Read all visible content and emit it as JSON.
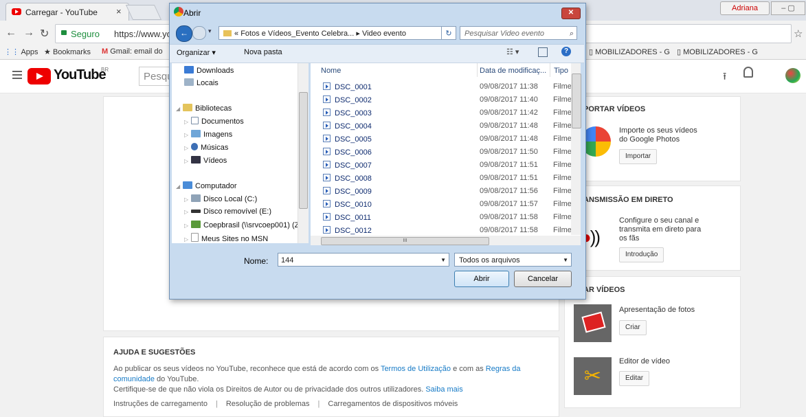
{
  "browser": {
    "tab_title": "Carregar - YouTube",
    "tab_close": "×",
    "user_badge": "Adriana",
    "secure_label": "Seguro",
    "url": "https://www.you",
    "bookmarks": [
      "Apps",
      "Bookmarks",
      "Gmail: email do",
      "MOBILIZADORES - G",
      "MOBILIZADORES - G"
    ]
  },
  "youtube": {
    "logo_text": "YouTube",
    "region": "BR",
    "search_placeholder": "Pesqu",
    "help": {
      "title": "AJUDA E SUGESTÕES",
      "p1_a": "Ao publicar os seus vídeos no YouTube, reconhece que está de acordo com os ",
      "p1_link1": "Termos de Utilização",
      "p1_b": " e com as ",
      "p1_link2": "Regras da comunidade",
      "p1_c": " do YouTube.",
      "p2": "Certifique-se de que não viola os Direitos de Autor ou de privacidade dos outros utilizadores. ",
      "p2_link": "Saiba mais",
      "links": [
        "Instruções de carregamento",
        "Resolução de problemas",
        "Carregamentos de dispositivos móveis"
      ]
    },
    "cards": {
      "import_title": "PORTAR VÍDEOS",
      "import_desc": [
        "Importe os seus vídeos",
        "do Google Photos"
      ],
      "import_btn": "Importar",
      "live_title": "ANSMISSÃO EM DIRETO",
      "live_desc": [
        "Configure o seu canal e",
        "transmita em direto para",
        "os fãs"
      ],
      "live_btn": "Introdução",
      "create_title": "AR VÍDEOS",
      "slideshow_desc": "Apresentação de fotos",
      "slideshow_btn": "Criar",
      "editor_desc": "Editor de vídeo",
      "editor_btn": "Editar"
    }
  },
  "dialog": {
    "title": "Abrir",
    "path_prefix": "«",
    "path_parent": "Fotos e Vídeos_Evento Celebra...",
    "path_sep": "▸",
    "path_current": "Video evento",
    "search_placeholder": "Pesquisar Video evento",
    "toolbar": {
      "organize": "Organizar ▾",
      "new_folder": "Nova pasta"
    },
    "nav_tree": {
      "downloads": "Downloads",
      "locais": "Locais",
      "bibliotecas": "Bibliotecas",
      "documentos": "Documentos",
      "imagens": "Imagens",
      "musicas": "Músicas",
      "videos": "Vídeos",
      "computador": "Computador",
      "disco_local": "Disco Local (C:)",
      "disco_removivel": "Disco removível (E:)",
      "coepbrasil": "Coepbrasil (\\\\srvcoep001) (Z",
      "msn": "Meus Sites no MSN"
    },
    "columns": {
      "name": "Nome",
      "date": "Data de modificaç...",
      "type": "Tipo"
    },
    "files": [
      {
        "name": "DSC_0001",
        "date": "09/08/2017 11:38",
        "type": "Filme"
      },
      {
        "name": "DSC_0002",
        "date": "09/08/2017 11:40",
        "type": "Filme"
      },
      {
        "name": "DSC_0003",
        "date": "09/08/2017 11:42",
        "type": "Filme"
      },
      {
        "name": "DSC_0004",
        "date": "09/08/2017 11:48",
        "type": "Filme"
      },
      {
        "name": "DSC_0005",
        "date": "09/08/2017 11:48",
        "type": "Filme"
      },
      {
        "name": "DSC_0006",
        "date": "09/08/2017 11:50",
        "type": "Filme"
      },
      {
        "name": "DSC_0007",
        "date": "09/08/2017 11:51",
        "type": "Filme"
      },
      {
        "name": "DSC_0008",
        "date": "09/08/2017 11:51",
        "type": "Filme"
      },
      {
        "name": "DSC_0009",
        "date": "09/08/2017 11:56",
        "type": "Filme"
      },
      {
        "name": "DSC_0010",
        "date": "09/08/2017 11:57",
        "type": "Filme"
      },
      {
        "name": "DSC_0011",
        "date": "09/08/2017 11:58",
        "type": "Filme"
      },
      {
        "name": "DSC_0012",
        "date": "09/08/2017 11:58",
        "type": "Filme"
      }
    ],
    "name_label": "Nome:",
    "name_value": "144",
    "filter_value": "Todos os arquivos",
    "open_label": "Abrir",
    "cancel_label": "Cancelar",
    "scroll_grip": "III"
  }
}
